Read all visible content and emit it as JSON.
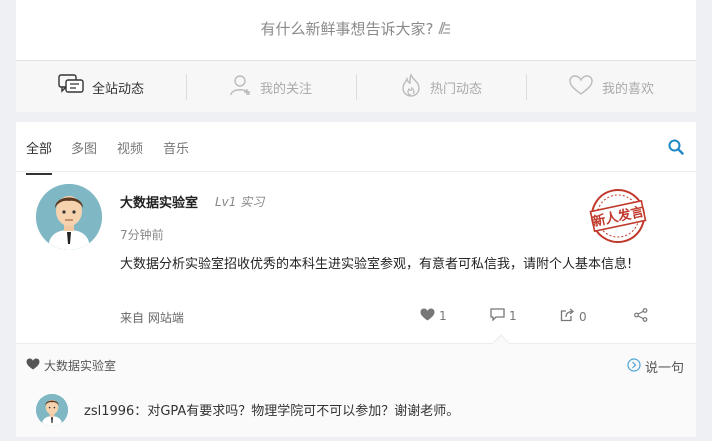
{
  "prompt": {
    "text": "有什么新鲜事想告诉大家?"
  },
  "nav": {
    "items": [
      {
        "label": "全站动态",
        "icon": "chat-bubbles-icon",
        "active": true
      },
      {
        "label": "我的关注",
        "icon": "user-add-icon",
        "active": false
      },
      {
        "label": "热门动态",
        "icon": "flame-icon",
        "active": false
      },
      {
        "label": "我的喜欢",
        "icon": "heart-outline-icon",
        "active": false
      }
    ]
  },
  "filters": {
    "tabs": [
      "全部",
      "多图",
      "视频",
      "音乐"
    ],
    "active": "全部",
    "search_icon": "search-icon"
  },
  "post": {
    "author": "大数据实验室",
    "level": "Lv1 实习",
    "time": "7分钟前",
    "content": "大数据分析实验室招收优秀的本科生进实验室参观，有意者可私信我，请附个人基本信息!",
    "source_prefix": "来自",
    "source": "网站端",
    "stamp_text": "新人发言",
    "stamp_color": "#c0392b",
    "likes": "1",
    "comments": "1",
    "shares": "0"
  },
  "comments": {
    "owner": "大数据实验室",
    "say_label": "说一句",
    "items": [
      {
        "user": "zsl1996",
        "separator": "：",
        "text": "对GPA有要求吗？物理学院可不可以参加？谢谢老师。"
      }
    ]
  },
  "colors": {
    "accent": "#1e88c7",
    "page_bg": "#eef0f3"
  }
}
